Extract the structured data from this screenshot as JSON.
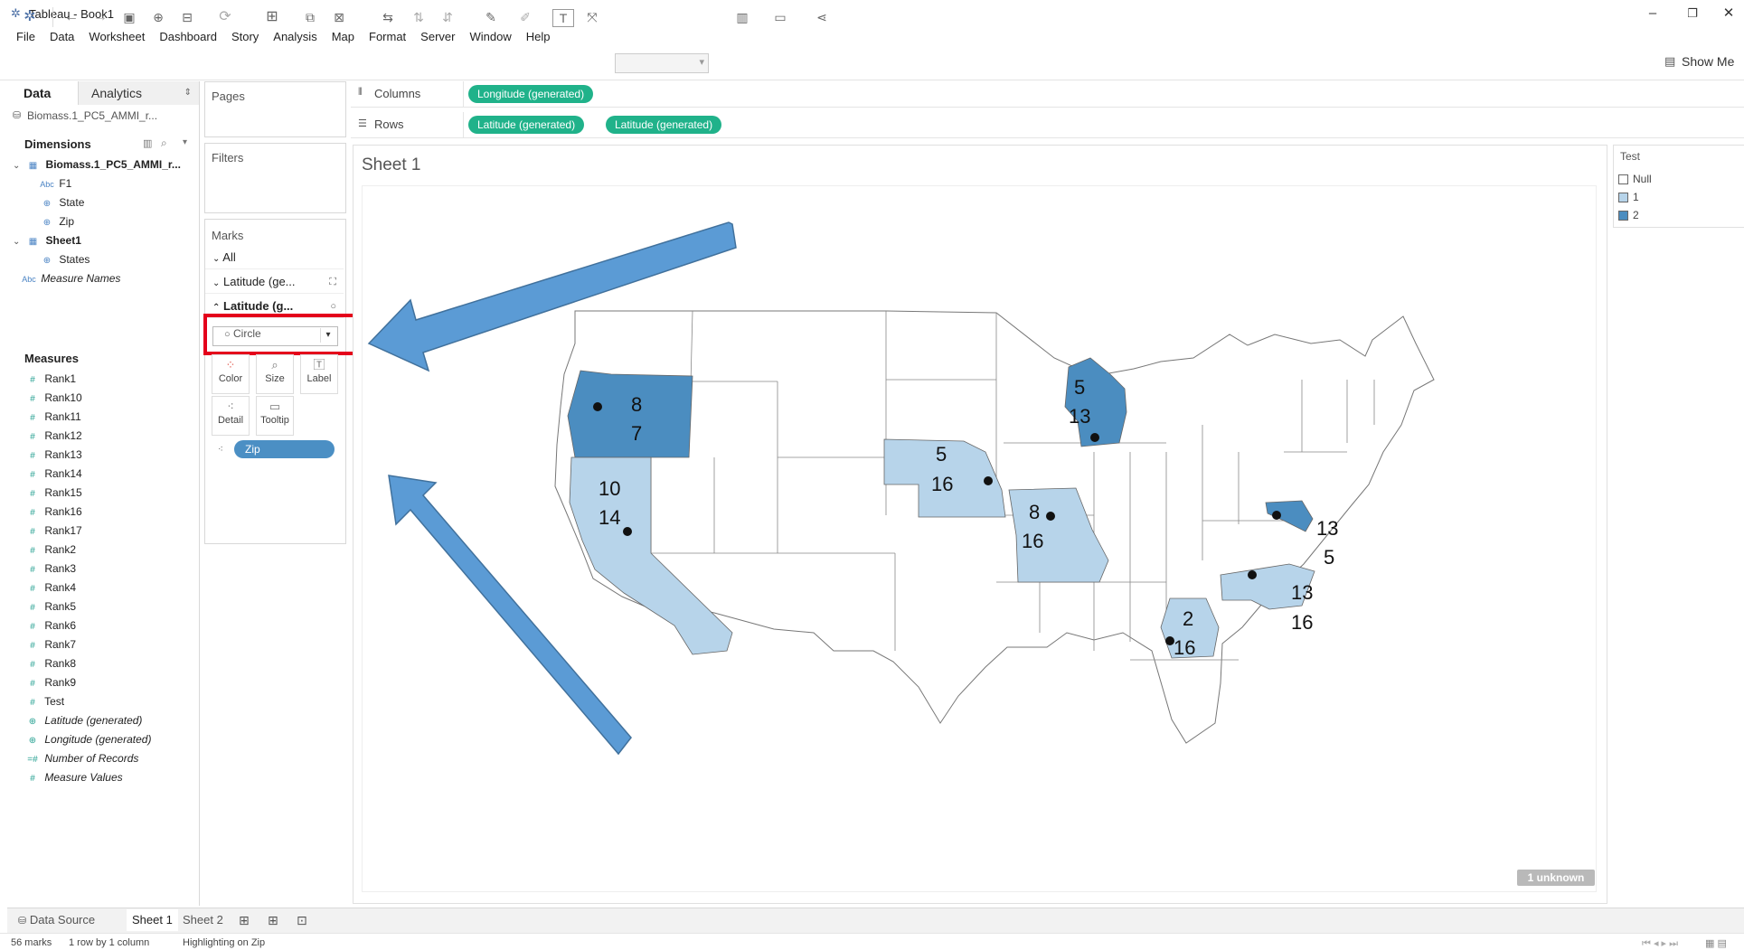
{
  "window": {
    "title": "Tableau - Book1"
  },
  "menu": [
    "File",
    "Data",
    "Worksheet",
    "Dashboard",
    "Story",
    "Analysis",
    "Map",
    "Format",
    "Server",
    "Window",
    "Help"
  ],
  "toolbar": {
    "show_me": "Show Me"
  },
  "data_pane": {
    "tab_data": "Data",
    "tab_analytics": "Analytics",
    "data_source": "Biomass.1_PC5_AMMI_r...",
    "dimensions_title": "Dimensions",
    "dimension_groups": [
      {
        "name": "Biomass.1_PC5_AMMI_r...",
        "fields": [
          {
            "label": "F1",
            "type": "Abc"
          },
          {
            "label": "State",
            "type": "geo"
          },
          {
            "label": "Zip",
            "type": "geo"
          }
        ]
      },
      {
        "name": "Sheet1",
        "fields": [
          {
            "label": "States",
            "type": "geo"
          }
        ]
      }
    ],
    "measure_names": "Measure Names",
    "measures_title": "Measures",
    "measures": [
      "Rank1",
      "Rank10",
      "Rank11",
      "Rank12",
      "Rank13",
      "Rank14",
      "Rank15",
      "Rank16",
      "Rank17",
      "Rank2",
      "Rank3",
      "Rank4",
      "Rank5",
      "Rank6",
      "Rank7",
      "Rank8",
      "Rank9",
      "Test"
    ],
    "generated_measures": [
      "Latitude (generated)",
      "Longitude (generated)",
      "Number of Records",
      "Measure Values"
    ]
  },
  "shelves": {
    "pages": "Pages",
    "filters": "Filters",
    "columns_label": "Columns",
    "rows_label": "Rows",
    "columns_pills": [
      "Longitude (generated)"
    ],
    "rows_pills": [
      "Latitude (generated)",
      "Latitude (generated)"
    ]
  },
  "marks": {
    "title": "Marks",
    "all": "All",
    "layer1": "Latitude (ge...",
    "layer2": "Latitude (g...",
    "mark_type": "Circle",
    "buttons": [
      "Color",
      "Size",
      "Label",
      "Detail",
      "Tooltip"
    ],
    "detail_pill": "Zip"
  },
  "view": {
    "sheet_title": "Sheet 1",
    "unknown_badge": "1 unknown",
    "legend_title": "Test",
    "legend": [
      {
        "label": "Null",
        "color": "#ffffff"
      },
      {
        "label": "1",
        "color": "#b7d4ea"
      },
      {
        "label": "2",
        "color": "#4b8dc0"
      }
    ],
    "states": [
      {
        "name": "Oregon",
        "labels": [
          "8",
          "7"
        ],
        "test": "2"
      },
      {
        "name": "California",
        "labels": [
          "10",
          "14"
        ],
        "test": "1"
      },
      {
        "name": "Nebraska",
        "labels": [
          "5",
          "16"
        ],
        "test": "1"
      },
      {
        "name": "Wisconsin",
        "labels": [
          "5",
          "13"
        ],
        "test": "2"
      },
      {
        "name": "Missouri",
        "labels": [
          "8",
          "16"
        ],
        "test": "1"
      },
      {
        "name": "Maryland",
        "labels": [
          "13",
          "5"
        ],
        "test": "2"
      },
      {
        "name": "North Carolina",
        "labels": [
          "13",
          "16"
        ],
        "test": "1"
      },
      {
        "name": "Georgia",
        "labels": [
          "2",
          "16"
        ],
        "test": "1"
      }
    ]
  },
  "bottom": {
    "data_source_tab": "Data Source",
    "sheets": [
      "Sheet 1",
      "Sheet 2"
    ],
    "status": [
      "56 marks",
      "1 row by 1 column",
      "Highlighting on Zip"
    ]
  }
}
